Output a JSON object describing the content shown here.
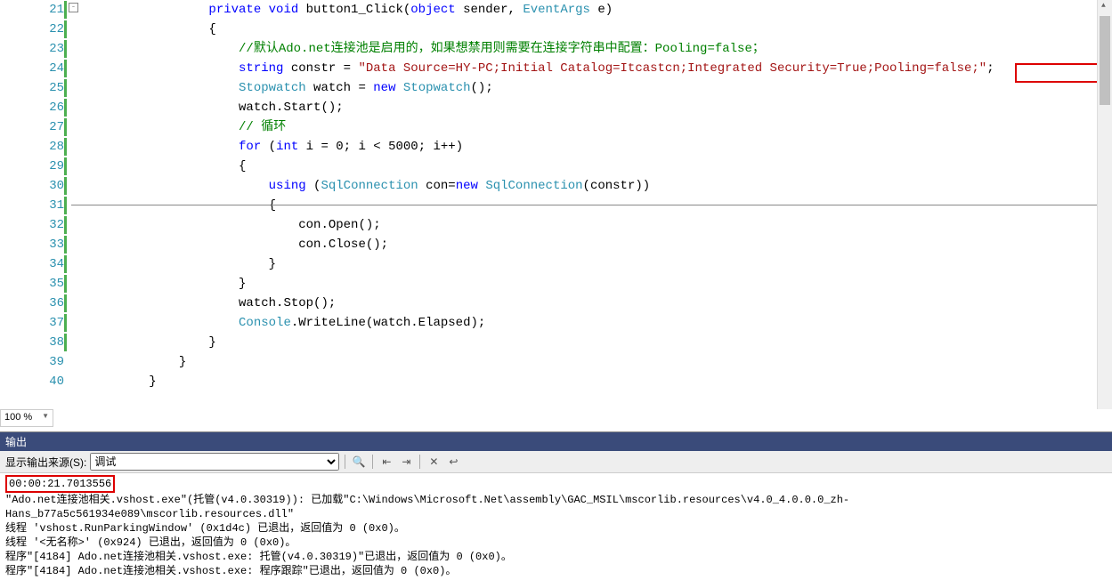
{
  "editor": {
    "zoom": "100 %",
    "lines": [
      {
        "num": 21,
        "mod": true,
        "collapse": "-",
        "indent": 8,
        "tokens": [
          [
            "kw",
            "private"
          ],
          [
            "plain",
            " "
          ],
          [
            "kw",
            "void"
          ],
          [
            "plain",
            " button1_Click("
          ],
          [
            "kw",
            "object"
          ],
          [
            "plain",
            " sender, "
          ],
          [
            "type",
            "EventArgs"
          ],
          [
            "plain",
            " e)"
          ]
        ]
      },
      {
        "num": 22,
        "mod": true,
        "indent": 8,
        "tokens": [
          [
            "plain",
            "{"
          ]
        ]
      },
      {
        "num": 23,
        "mod": true,
        "indent": 10,
        "tokens": [
          [
            "comment",
            "//默认Ado.net连接池是启用的，如果想禁用则需要在连接字符串中配置：Pooling=false；"
          ]
        ]
      },
      {
        "num": 24,
        "mod": true,
        "indent": 10,
        "tokens": [
          [
            "kw",
            "string"
          ],
          [
            "plain",
            " constr = "
          ],
          [
            "str",
            "\"Data Source=HY-PC;Initial Catalog=Itcastcn;Integrated Security=True;Pooling=false;\""
          ],
          [
            "plain",
            ";"
          ]
        ]
      },
      {
        "num": 25,
        "mod": true,
        "indent": 10,
        "tokens": [
          [
            "type",
            "Stopwatch"
          ],
          [
            "plain",
            " watch = "
          ],
          [
            "kw",
            "new"
          ],
          [
            "plain",
            " "
          ],
          [
            "type",
            "Stopwatch"
          ],
          [
            "plain",
            "();"
          ]
        ]
      },
      {
        "num": 26,
        "mod": true,
        "indent": 10,
        "tokens": [
          [
            "plain",
            "watch.Start();"
          ]
        ]
      },
      {
        "num": 27,
        "mod": true,
        "indent": 10,
        "tokens": [
          [
            "comment",
            "// 循环"
          ]
        ]
      },
      {
        "num": 28,
        "mod": true,
        "indent": 10,
        "tokens": [
          [
            "kw",
            "for"
          ],
          [
            "plain",
            " ("
          ],
          [
            "kw",
            "int"
          ],
          [
            "plain",
            " i = 0; i < 5000; i++)"
          ]
        ]
      },
      {
        "num": 29,
        "mod": true,
        "indent": 10,
        "tokens": [
          [
            "plain",
            "{"
          ]
        ]
      },
      {
        "num": 30,
        "mod": true,
        "indent": 12,
        "tokens": [
          [
            "kw",
            "using"
          ],
          [
            "plain",
            " ("
          ],
          [
            "type",
            "SqlConnection"
          ],
          [
            "plain",
            " con="
          ],
          [
            "kw",
            "new"
          ],
          [
            "plain",
            " "
          ],
          [
            "type",
            "SqlConnection"
          ],
          [
            "plain",
            "(constr))"
          ]
        ]
      },
      {
        "num": 31,
        "mod": true,
        "indent": 12,
        "tokens": [
          [
            "plain",
            "{"
          ]
        ]
      },
      {
        "num": 32,
        "mod": true,
        "indent": 14,
        "tokens": [
          [
            "plain",
            "con.Open();"
          ]
        ]
      },
      {
        "num": 33,
        "mod": true,
        "indent": 14,
        "tokens": [
          [
            "plain",
            "con.Close();"
          ]
        ]
      },
      {
        "num": 34,
        "mod": true,
        "indent": 12,
        "tokens": [
          [
            "plain",
            "}"
          ]
        ]
      },
      {
        "num": 35,
        "mod": true,
        "indent": 10,
        "tokens": [
          [
            "plain",
            "}"
          ]
        ]
      },
      {
        "num": 36,
        "mod": true,
        "indent": 10,
        "tokens": [
          [
            "plain",
            "watch.Stop();"
          ]
        ]
      },
      {
        "num": 37,
        "mod": true,
        "indent": 10,
        "tokens": [
          [
            "type",
            "Console"
          ],
          [
            "plain",
            ".WriteLine(watch.Elapsed);"
          ]
        ]
      },
      {
        "num": 38,
        "mod": true,
        "indent": 8,
        "tokens": [
          [
            "plain",
            "}"
          ]
        ]
      },
      {
        "num": 39,
        "mod": false,
        "indent": 6,
        "tokens": [
          [
            "plain",
            "}"
          ]
        ]
      },
      {
        "num": 40,
        "mod": false,
        "indent": 4,
        "tokens": [
          [
            "plain",
            "}"
          ]
        ]
      }
    ]
  },
  "output": {
    "title": "输出",
    "source_label": "显示输出来源(S):",
    "source_value": "调试",
    "time": "00:00:21.7013556",
    "body": [
      "\"Ado.net连接池相关.vshost.exe\"(托管(v4.0.30319)): 已加载\"C:\\Windows\\Microsoft.Net\\assembly\\GAC_MSIL\\mscorlib.resources\\v4.0_4.0.0.0_zh-Hans_b77a5c561934e089\\mscorlib.resources.dll\"",
      "线程 'vshost.RunParkingWindow' (0x1d4c) 已退出，返回值为 0 (0x0)。",
      "线程 '<无名称>' (0x924) 已退出，返回值为 0 (0x0)。",
      "程序\"[4184] Ado.net连接池相关.vshost.exe: 托管(v4.0.30319)\"已退出，返回值为 0 (0x0)。",
      "程序\"[4184] Ado.net连接池相关.vshost.exe: 程序跟踪\"已退出，返回值为 0 (0x0)。"
    ]
  }
}
